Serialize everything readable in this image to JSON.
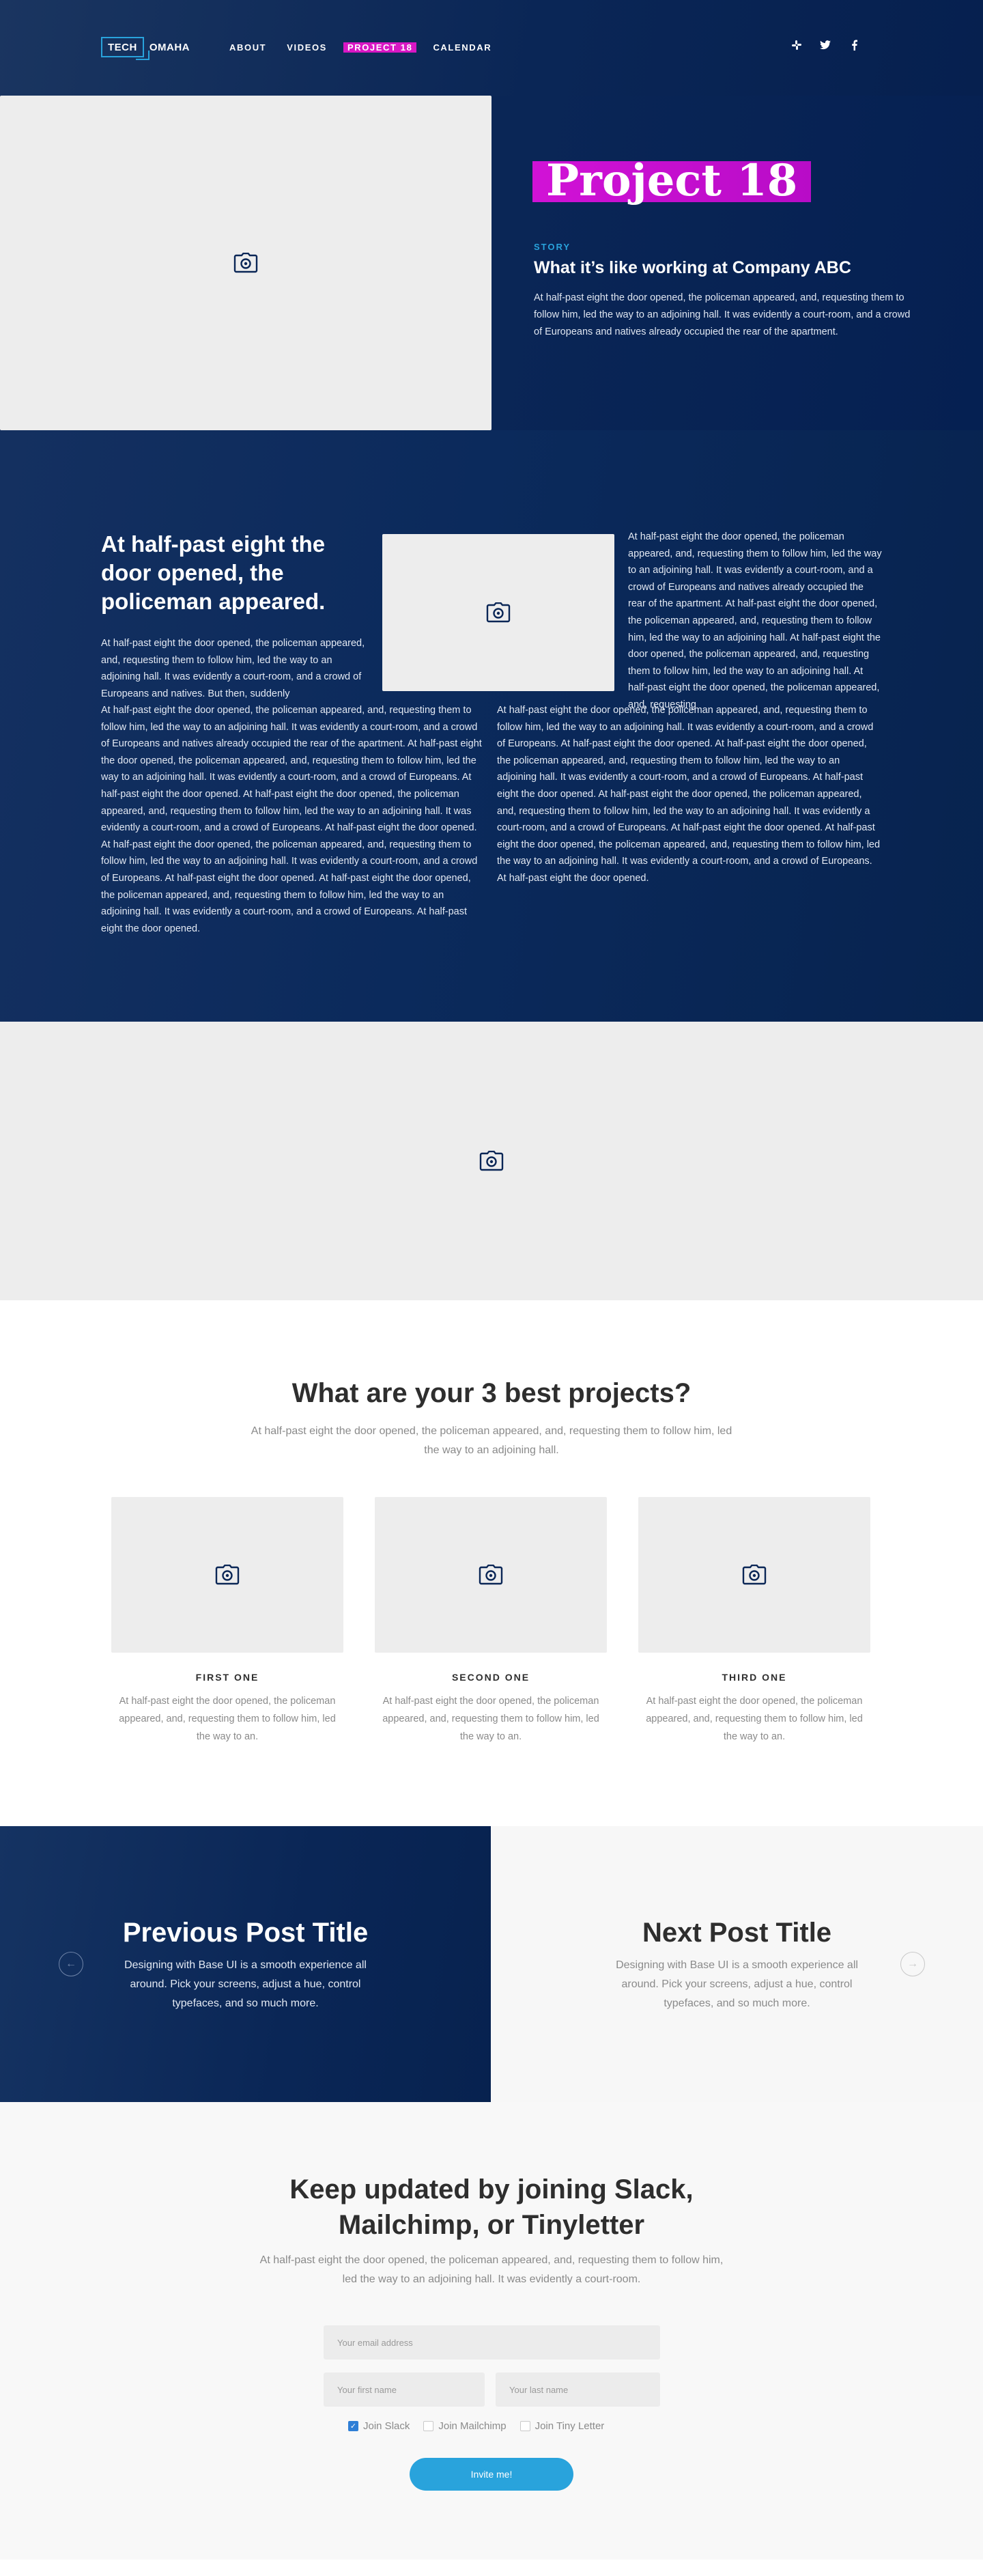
{
  "header": {
    "logo_part1": "TECH",
    "logo_part2": "OMAHA",
    "nav": [
      {
        "label": "ABOUT",
        "active": false
      },
      {
        "label": "VIDEOS",
        "active": false
      },
      {
        "label": "PROJECT 18",
        "active": true
      },
      {
        "label": "CALENDAR",
        "active": false
      }
    ],
    "social_icons": [
      "slack-icon",
      "twitter-icon",
      "facebook-icon"
    ]
  },
  "hero": {
    "image_icon": "camera-icon",
    "title": "Project 18",
    "eyebrow": "STORY",
    "subtitle": "What it’s like working at Company ABC",
    "text": "At half-past eight the door opened, the policeman appeared, and, requesting them to follow him, led the way to an adjoining hall. It was evidently a court-room, and a crowd of Europeans and natives already occupied the rear of the apartment."
  },
  "article": {
    "heading": "At half-past eight the door opened, the policeman appeared.",
    "image_icon": "camera-icon",
    "text_right": "At half-past eight the door opened, the policeman appeared, and, requesting them to follow him, led the way to an adjoining hall. It was evidently a court-room, and a crowd of Europeans and natives already occupied the rear of the apartment. At half-past eight the door opened, the policeman appeared, and, requesting them to follow him, led the way to an adjoining hall. At half-past eight the door opened, the policeman appeared, and, requesting them to follow him, led the way to an adjoining hall. At half-past eight the door opened, the policeman appeared, and, requesting",
    "text_left": "At half-past eight the door opened, the policeman appeared, and, requesting them to follow him, led the way to an adjoining hall. It was evidently a court-room, and a crowd of Europeans and natives. But then, suddenly",
    "text_col_a": "At half-past eight the door opened, the policeman appeared, and, requesting them to follow him, led the way to an adjoining hall. It was evidently a court-room, and a crowd of Europeans and natives already occupied the rear of the apartment. At half-past eight the door opened, the policeman appeared, and, requesting them to follow him, led the way to an adjoining hall. It was evidently a court-room, and a crowd of Europeans. At half-past eight the door opened.  At half-past eight the door opened, the policeman appeared, and, requesting them to follow him, led the way to an adjoining hall. It was evidently a court-room, and a crowd of Europeans. At half-past eight the door opened.  At half-past eight the door opened, the policeman appeared, and, requesting them to follow him, led the way to an adjoining hall. It was evidently a court-room, and a crowd of Europeans. At half-past eight the door opened.  At half-past eight the door opened, the policeman appeared, and, requesting them to follow him, led the way to an adjoining hall. It was evidently a court-room, and a crowd of Europeans. At half-past eight the door opened.",
    "text_col_b": "At half-past eight the door opened, the policeman appeared, and, requesting them to follow him, led the way to an adjoining hall. It was evidently a court-room, and a crowd of Europeans. At half-past eight the door opened.  At half-past eight the door opened, the policeman appeared, and, requesting them to follow him, led the way to an adjoining hall. It was evidently a court-room, and a crowd of Europeans. At half-past eight the door opened.  At half-past eight the door opened, the policeman appeared, and, requesting them to follow him, led the way to an adjoining hall. It was evidently a court-room, and a crowd of Europeans. At half-past eight the door opened.  At half-past eight the door opened, the policeman appeared, and, requesting them to follow him, led the way to an adjoining hall. It was evidently a court-room, and a crowd of Europeans. At half-past eight the door opened."
  },
  "wide_image": {
    "icon": "camera-icon"
  },
  "projects": {
    "title": "What are your 3 best projects?",
    "subtitle": "At half-past eight the door opened, the policeman appeared, and, requesting them to follow him, led the way to an adjoining hall.",
    "cards": [
      {
        "name": "FIRST ONE",
        "text": "At half-past eight the door opened, the policeman appeared, and, requesting them to follow him, led the way to an."
      },
      {
        "name": "SECOND ONE",
        "text": "At half-past eight the door opened, the policeman appeared, and, requesting them to follow him, led the way to an."
      },
      {
        "name": "THIRD ONE",
        "text": "At half-past eight the door opened, the policeman appeared, and, requesting them to follow him, led the way to an."
      }
    ]
  },
  "postnav": {
    "prev_title": "Previous Post Title",
    "prev_text": "Designing with Base UI is a smooth experience all around. Pick your screens, adjust a hue, control typefaces, and so much more.",
    "next_title": "Next Post Title",
    "next_text": "Designing with Base UI is a smooth experience all around. Pick your screens, adjust a hue, control typefaces, and so much more.",
    "prev_arrow": "←",
    "next_arrow": "→"
  },
  "newsletter": {
    "title_line1": "Keep updated by joining Slack,",
    "title_line2": "Mailchimp, or Tinyletter",
    "text": "At half-past eight the door opened, the policeman appeared, and, requesting them to follow him, led the way to an adjoining hall. It was evidently a court-room.",
    "email_placeholder": "Your email address",
    "first_placeholder": "Your first name",
    "last_placeholder": "Your last name",
    "options": [
      {
        "label": "Join Slack",
        "checked": true
      },
      {
        "label": "Join Mailchimp",
        "checked": false
      },
      {
        "label": "Join Tiny Letter",
        "checked": false
      }
    ],
    "button": "Invite me!"
  },
  "colors": {
    "navy": "#0a2656",
    "accent_magenta": "#d112d6",
    "accent_blue": "#29a3dc",
    "placeholder_gray": "#ededed"
  }
}
